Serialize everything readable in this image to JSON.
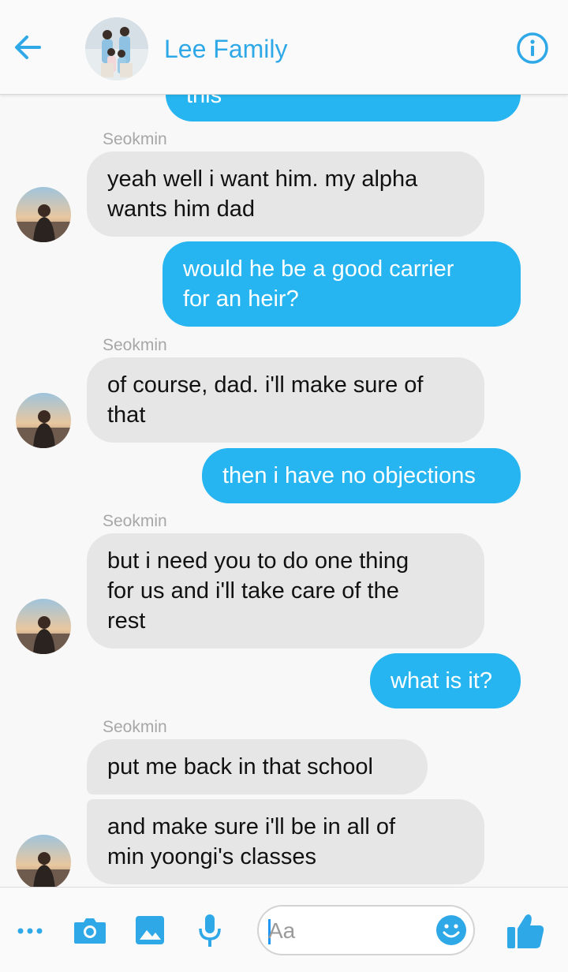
{
  "header": {
    "title": "Lee Family",
    "accent_color": "#2fa8e8",
    "back_icon": "arrow-left-icon",
    "info_icon": "info-icon"
  },
  "messages": {
    "top_partial": "this",
    "sender_1": "Seokmin",
    "in_1": [
      "yeah well i want him. my alpha",
      "wants him dad"
    ],
    "out_1": [
      "would he be a good carrier",
      "for an heir?"
    ],
    "sender_2": "Seokmin",
    "in_2": [
      "of course, dad. i'll make sure of",
      "that"
    ],
    "out_2": [
      "then i have no objections"
    ],
    "sender_3": "Seokmin",
    "in_3": [
      "but i need you to do one thing",
      "for us and i'll take care of the",
      "rest"
    ],
    "out_3": [
      "what is it?"
    ],
    "sender_4": "Seokmin",
    "in_4": [
      "put me back in that school"
    ],
    "in_5": [
      "and make sure i'll be in all of",
      "min yoongi's classes"
    ]
  },
  "composer": {
    "placeholder": "Aa",
    "more_icon": "more-dots-icon",
    "camera_icon": "camera-icon",
    "gallery_icon": "image-icon",
    "mic_icon": "microphone-icon",
    "emoji_icon": "smiley-icon",
    "like_icon": "thumbs-up-icon"
  },
  "colors": {
    "outgoing_bubble": "#26b5f0",
    "incoming_bubble": "#e6e6e6",
    "icon_blue": "#2fa8e8"
  }
}
